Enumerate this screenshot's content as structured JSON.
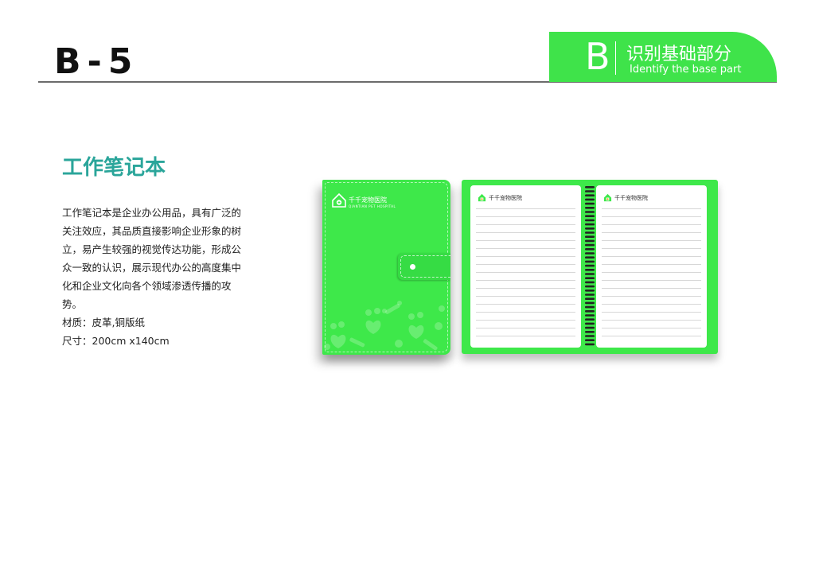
{
  "header": {
    "page_code": "B-5",
    "section_letter": "B",
    "section_title": "识别基础部分",
    "section_subtitle": "Identify the base part"
  },
  "content": {
    "title": "工作笔记本",
    "description_lines": [
      "工作笔记本是企业办公用品，具有广泛的",
      "关注效应，其品质直接影响企业形象的树",
      "立，易产生较强的视觉传达功能，形成公",
      "众一致的认识，展示现代办公的高度集中",
      "化和企业文化向各个领域渗透传播的攻",
      "势。"
    ],
    "material": "材质：皮革,铜版纸",
    "size": "尺寸：200cm x140cm"
  },
  "mockup": {
    "cover_logo_name": "千千宠物医院",
    "cover_logo_sub": "QIANTIAN PET HOSPITAL",
    "page_logo_name": "千千宠物医院"
  },
  "colors": {
    "brand_green": "#3ee84a",
    "title_teal": "#2aa59a",
    "page_white": "#ffffff"
  }
}
